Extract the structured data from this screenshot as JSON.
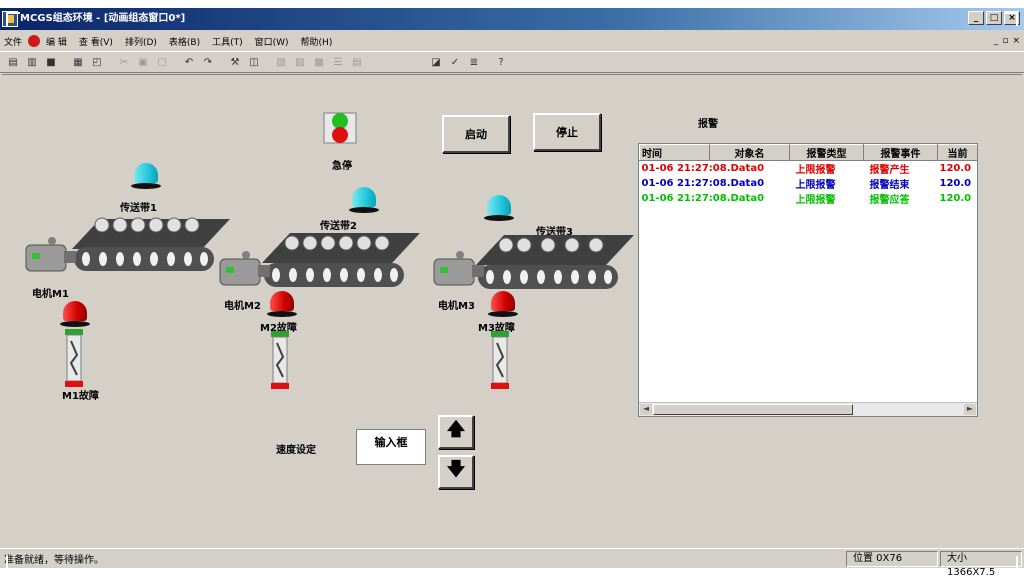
{
  "window": {
    "title": "MCGS组态环境 - [动画组态窗口0*]"
  },
  "menu": {
    "items": [
      "文件",
      "编 辑",
      "查 看(V)",
      "排列(D)",
      "表格(B)",
      "工具(T)",
      "窗口(W)",
      "帮助(H)"
    ],
    "mdi_controls": [
      "_",
      "▫",
      "×"
    ]
  },
  "scene": {
    "estop_label": "急停",
    "start_label": "启动",
    "stop_label": "停止",
    "conveyor1": "传送带1",
    "conveyor2": "传送带2",
    "conveyor3": "传送带3",
    "motor1": "电机M1",
    "motor2": "电机M2",
    "motor3": "电机M3",
    "fault1": "M1故障",
    "fault2": "M2故障",
    "fault3": "M3故障",
    "speed_label": "速度设定",
    "input_label": "输入框",
    "alarm_title": "报警"
  },
  "alarm_table": {
    "headers": [
      "时间",
      "对象名",
      "报警类型",
      "报警事件",
      "当前"
    ],
    "rows": [
      {
        "time_obj": "01-06 21:27:08.Data0",
        "type": "上限报警",
        "event": "报警产生",
        "value": "120.0",
        "color": "#e00000"
      },
      {
        "time_obj": "01-06 21:27:08.Data0",
        "type": "上限报警",
        "event": "报警结束",
        "value": "120.0",
        "color": "#0000c0"
      },
      {
        "time_obj": "01-06 21:27:08.Data0",
        "type": "上限报警",
        "event": "报警应答",
        "value": "120.0",
        "color": "#00c000"
      }
    ]
  },
  "status": {
    "main": "准备就绪，等待操作。",
    "position": "位置 0X76",
    "size": "大小 1366X7.5"
  },
  "colors": {
    "title_bar": "#0a246a",
    "panel": "#d4d0c8",
    "lamp_cyan": "#20c8dc",
    "lamp_red": "#d00000"
  }
}
